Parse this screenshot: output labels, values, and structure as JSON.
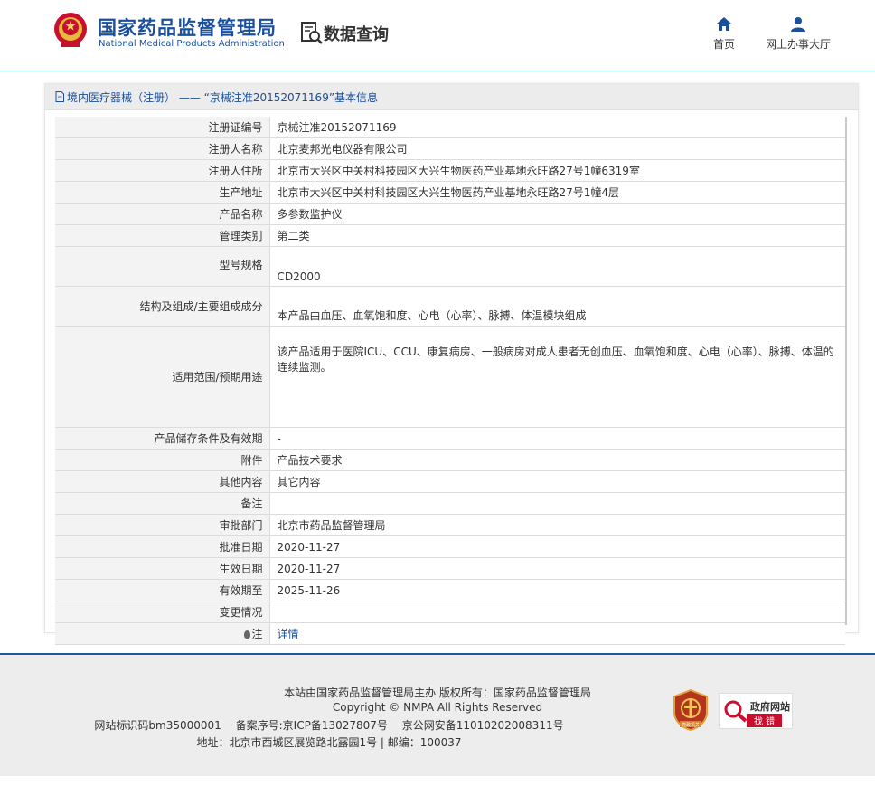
{
  "header": {
    "logo_cn": "国家药品监督管理局",
    "logo_en": "National Medical Products Administration",
    "query_label": "数据查询",
    "nav": [
      {
        "label": "首页",
        "icon": "home-icon"
      },
      {
        "label": "网上办事大厅",
        "icon": "user-icon"
      }
    ]
  },
  "panel": {
    "title": "境内医疗器械（注册） —— “京械注准20152071169”基本信息"
  },
  "record": {
    "reg_no_label": "注册证编号",
    "reg_no": "京械注准20152071169",
    "registrant_label": "注册人名称",
    "registrant": "北京麦邦光电仪器有限公司",
    "residence_label": "注册人住所",
    "residence": "北京市大兴区中关村科技园区大兴生物医药产业基地永旺路27号1幢6319室",
    "production_label": "生产地址",
    "production": "北京市大兴区中关村科技园区大兴生物医药产业基地永旺路27号1幢4层",
    "product_label": "产品名称",
    "product": "多参数监护仪",
    "class_label": "管理类别",
    "class": "第二类",
    "model_label": "型号规格",
    "model": "CD2000",
    "structure_label": "结构及组成/主要组成成分",
    "structure": "本产品由血压、血氧饱和度、心电（心率）、脉搏、体温模块组成",
    "scope_label": "适用范围/预期用途",
    "scope": "该产品适用于医院ICU、CCU、康复病房、一般病房对成人患者无创血压、血氧饱和度、心电（心率）、脉搏、体温的连续监测。",
    "storage_label": "产品储存条件及有效期",
    "storage": "-",
    "attachment_label": "附件",
    "attachment": "产品技术要求",
    "other_label": "其他内容",
    "other": "其它内容",
    "remark_label": "备注",
    "remark": "",
    "approver_label": "审批部门",
    "approver": "北京市药品监督管理局",
    "approve_date_label": "批准日期",
    "approve_date": "2020-11-27",
    "effective_date_label": "生效日期",
    "effective_date": "2020-11-27",
    "valid_until_label": "有效期至",
    "valid_until": "2025-11-26",
    "change_label": "变更情况",
    "change": "",
    "note_label": "注",
    "note_link": "详情"
  },
  "footer": {
    "line1": "本站由国家药品监督管理局主办 版权所有：国家药品监督管理局",
    "line2": "Copyright © NMPA All Rights Reserved",
    "line3": "网站标识码bm35000001　 备案序号:京ICP备13027807号　 京公网安备11010202008311号",
    "line4": "地址：北京市西城区展览路北露园1号 | 邮编：100037",
    "badge_gov_line1": "政府网站",
    "badge_gov_line2": "找 错",
    "badge_party_text": "党政机关"
  },
  "colors": {
    "brand": "#1a4f9c",
    "accent_red": "#c8102e"
  }
}
